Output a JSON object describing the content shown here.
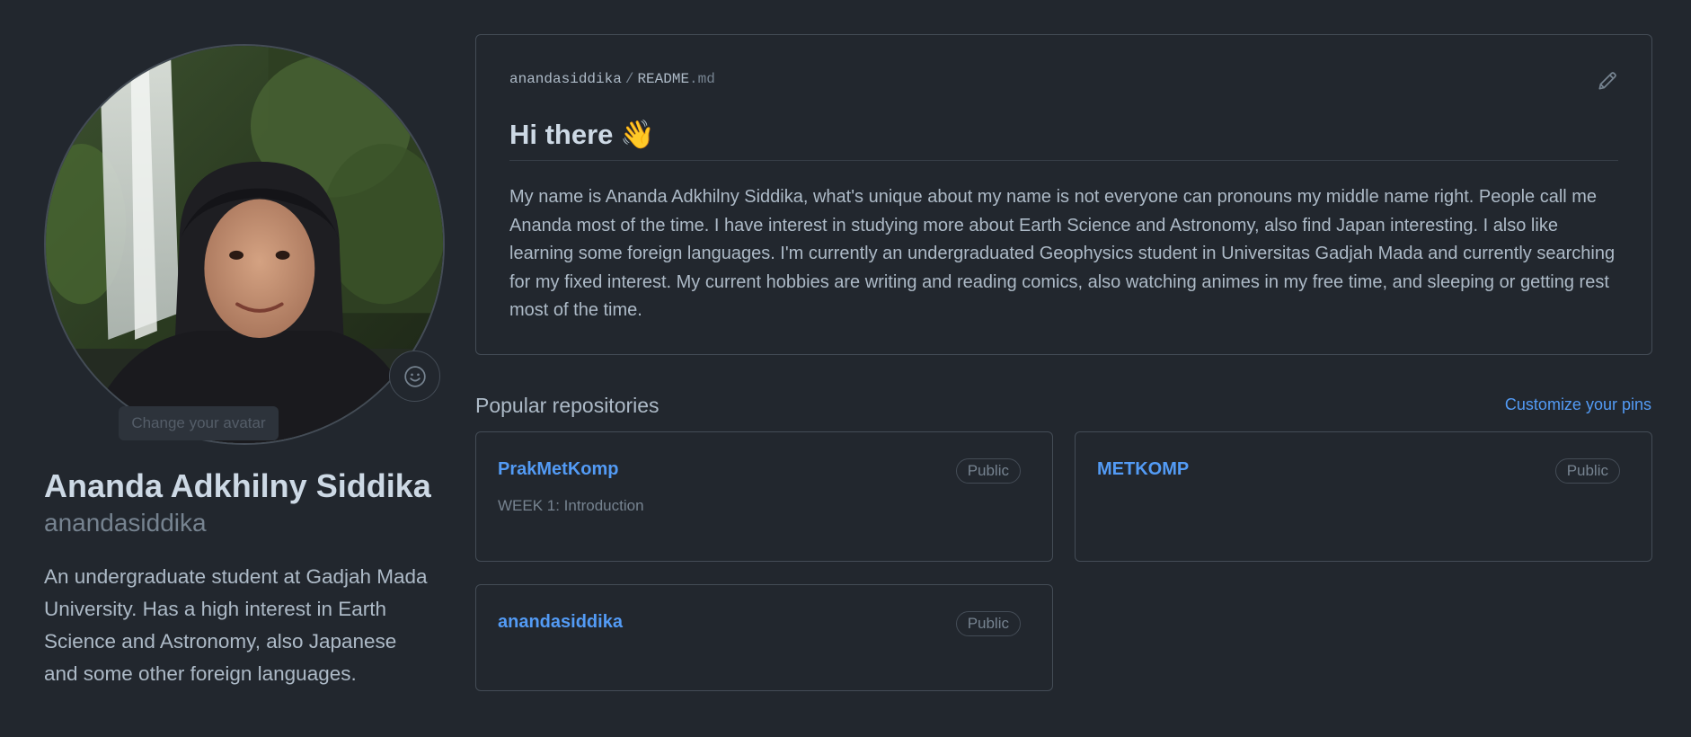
{
  "profile": {
    "change_avatar_tooltip": "Change your avatar",
    "full_name": "Ananda Adkhilny Siddika",
    "username": "anandasiddika",
    "bio": "An undergraduate student at Gadjah Mada University. Has a high interest in Earth Science and Astronomy, also Japanese and some other foreign languages."
  },
  "readme": {
    "owner": "anandasiddika",
    "separator": "/",
    "file_base": "README",
    "file_ext": ".md",
    "heading": "Hi there",
    "heading_emoji": "👋",
    "body": "My name is Ananda Adkhilny Siddika, what's unique about my name is not everyone can pronouns my middle name right. People call me Ananda most of the time. I have interest in studying more about Earth Science and Astronomy, also find Japan interesting. I also like learning some foreign languages. I'm currently an undergraduated Geophysics student in Universitas Gadjah Mada and currently searching for my fixed interest. My current hobbies are writing and reading comics, also watching animes in my free time, and sleeping or getting rest most of the time."
  },
  "popular": {
    "title": "Popular repositories",
    "customize_label": "Customize your pins",
    "repos": [
      {
        "name": "PrakMetKomp",
        "visibility": "Public",
        "description": "WEEK 1: Introduction"
      },
      {
        "name": "METKOMP",
        "visibility": "Public",
        "description": ""
      },
      {
        "name": "anandasiddika",
        "visibility": "Public",
        "description": ""
      }
    ]
  },
  "colors": {
    "background": "#22272e",
    "border": "#444c56",
    "link": "#539bf5",
    "text": "#adbac7",
    "heading": "#cdd9e5"
  },
  "icons": [
    "smiley-icon",
    "pencil-icon"
  ]
}
